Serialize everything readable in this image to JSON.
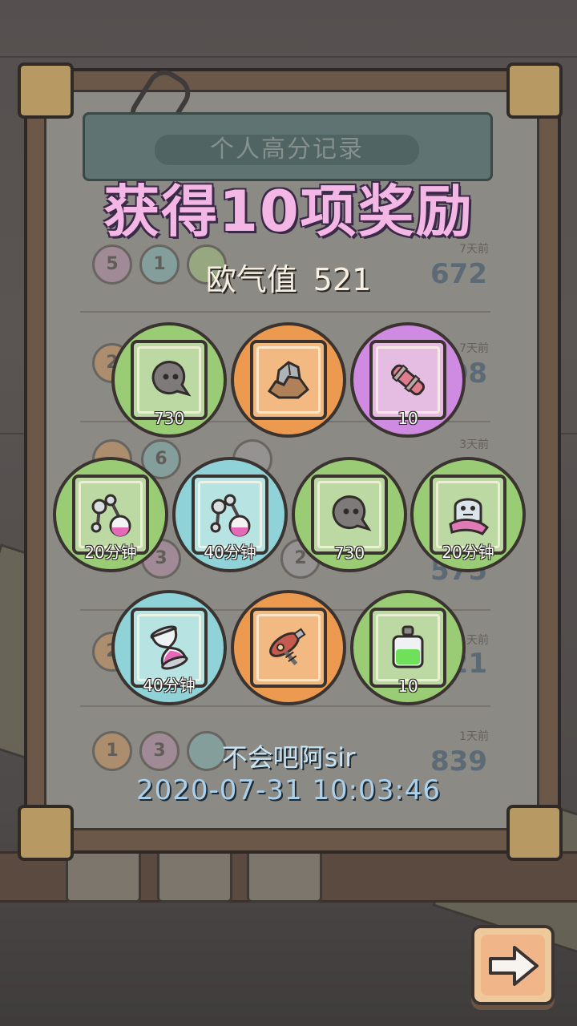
{
  "background": {
    "board_header": "个人高分记录",
    "rows": [
      {
        "balls": [
          "5",
          "1",
          ""
        ],
        "days": "7天前",
        "score": "672"
      },
      {
        "balls": [
          "2"
        ],
        "days": "7天前",
        "score": "608"
      },
      {
        "balls": [
          "",
          "6",
          ""
        ],
        "days": "3天前",
        "score": ""
      },
      {
        "balls": [
          "",
          "3",
          "",
          "2"
        ],
        "days": "",
        "score": "575"
      },
      {
        "balls": [
          "2"
        ],
        "days": "1天前",
        "score": "621"
      },
      {
        "balls": [
          "1",
          "3",
          ""
        ],
        "days": "1天前",
        "score": "839"
      }
    ]
  },
  "reward_popup": {
    "title": "获得10项奖励",
    "luck_label": "欧气值",
    "luck_value": "521",
    "user_name": "不会吧阿sir",
    "timestamp": "2020-07-31 10:03:46"
  },
  "rewards": [
    {
      "icon": "ghost-blob-icon",
      "ring": "green",
      "qty": "730"
    },
    {
      "icon": "rock-ore-icon",
      "ring": "orange",
      "qty": ""
    },
    {
      "icon": "scroll-cannon-icon",
      "ring": "purple",
      "qty": "10"
    },
    {
      "icon": "molecule-flask-icon",
      "ring": "green",
      "qty": "20分钟"
    },
    {
      "icon": "molecule-flask-icon",
      "ring": "teal",
      "qty": "40分钟"
    },
    {
      "icon": "ghost-blob-icon",
      "ring": "green",
      "qty": "730"
    },
    {
      "icon": "ghost-sheet-icon",
      "ring": "green",
      "qty": "20分钟"
    },
    {
      "icon": "hourglass-icon",
      "ring": "teal",
      "qty": "40分钟"
    },
    {
      "icon": "ray-gun-icon",
      "ring": "orange",
      "qty": ""
    },
    {
      "icon": "potion-bottle-icon",
      "ring": "green",
      "qty": "10"
    }
  ],
  "next_button": {
    "icon": "arrow-right-icon"
  }
}
